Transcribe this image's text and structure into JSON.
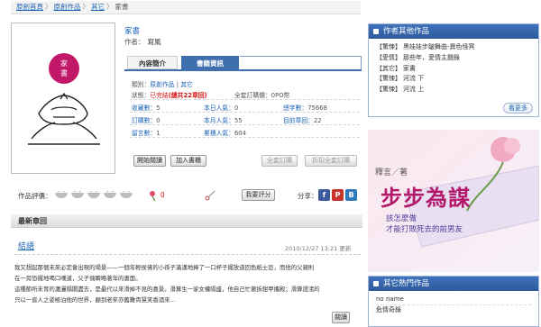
{
  "breadcrumb": {
    "items": [
      "原創首頁",
      "原創作品",
      "其它"
    ],
    "separator": "〉",
    "current": "家書"
  },
  "cover": {
    "seal_text": "家書"
  },
  "book": {
    "title": "家書",
    "author_label": "作者：",
    "author": "寫風"
  },
  "tabs": [
    {
      "label": "內容簡介",
      "active": false
    },
    {
      "label": "書籍資訊",
      "active": true
    }
  ],
  "info": {
    "category_label": "類別：",
    "category_value": "原創作品",
    "category_sep": "|",
    "category_sub": "其它",
    "status_label": "狀態：",
    "status_value": "已完結",
    "status_extra": "(總共22章回)",
    "price_label": "全套訂購價：",
    "price_value": "0PO幣",
    "r1": [
      {
        "label": "收藏數：",
        "value": "5"
      },
      {
        "label": "本日人氣：",
        "value": "0"
      },
      {
        "label": "總字數：",
        "value": "75668"
      }
    ],
    "r2": [
      {
        "label": "訂購數：",
        "value": "0"
      },
      {
        "label": "本月人氣：",
        "value": "55"
      },
      {
        "label": "目前章回：",
        "value": "22"
      }
    ],
    "r3": [
      {
        "label": "留言數：",
        "value": "1"
      },
      {
        "label": "累積人氣：",
        "value": "604"
      }
    ]
  },
  "buttons": {
    "start_reading": "開始閱讀",
    "add_bookshelf": "加入書櫃",
    "buy_all": "全套訂購",
    "buy_all_discount": "折扣全套訂購"
  },
  "rating": {
    "label": "作品評價：",
    "flower_count": "0",
    "report": "我要評分",
    "share_label": "分享："
  },
  "latest": {
    "section_title": "最新章回",
    "chapter_title": "結語",
    "time": "2010/12/27 13:21 更新",
    "body": [
      "我又想起那個未來必定會出現的場景——一個年輕侯佛的小孫子滿漢地捧了一口杯子擺放道回色紙士忌，而他的父親則",
      "在一旁恐擺地喝口嘆道，父子倆瞬略著年的畫面。",
      "這種節所未育的瀟灑隔閡盡去，是最代以來滑掉不見的喜景。滑算生一家女權隔盛，他自己忙著拆鉗甲攜殿；滑算證渚的",
      "只以一直人之姿極泊他的世界，顧到老來亦舊難貴慧笑香酒來..."
    ],
    "read_button": "閱讀"
  },
  "sidebar": {
    "other_works": {
      "title": "作者其他作品",
      "items": [
        {
          "cat": "【驚悚】",
          "name": "黑娃娃步皺舞曲-異色怪冥"
        },
        {
          "cat": "【愛情】",
          "name": "那些年，愛情主題錄"
        },
        {
          "cat": "【其它】",
          "name": "家書"
        },
        {
          "cat": "【驚悚】",
          "name": "河流 下"
        },
        {
          "cat": "【驚悚】",
          "name": "河流 上"
        }
      ],
      "more": "看更多"
    },
    "ad": {
      "line1": "釋言／著",
      "big": "步步為謀",
      "line2": "該怎麼做",
      "line3": "才能打敗死去的前男友"
    },
    "hot": {
      "title": "其它熱門作品",
      "items": [
        "no name",
        "危情奇錄"
      ]
    }
  },
  "colors": {
    "brand_blue": "#3f6fae",
    "link_blue": "#1a62b4",
    "alert_red": "#d51515",
    "seal_magenta": "#c2186a"
  }
}
